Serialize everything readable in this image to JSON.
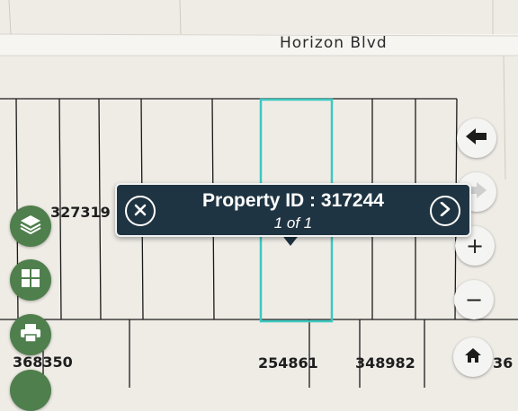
{
  "map": {
    "street_name": "Horizon Blvd",
    "parcel_labels": [
      "327319",
      "368350",
      "254861",
      "348982",
      "36"
    ],
    "highlight_color": "#3cc8c0"
  },
  "popup": {
    "title": "Property ID : 317244",
    "count": "1 of 1",
    "close_icon": "close-x-icon",
    "next_icon": "chevron-right-icon",
    "background_color": "#1f3442"
  },
  "toolbar_left": {
    "buttons": [
      "layers-icon",
      "basemap-grid-icon",
      "print-icon"
    ],
    "color": "#4f7f4c"
  },
  "toolbar_right": {
    "back_icon": "arrow-left-icon",
    "zoom_in_label": "+",
    "zoom_out_label": "−",
    "home_icon": "home-icon"
  }
}
